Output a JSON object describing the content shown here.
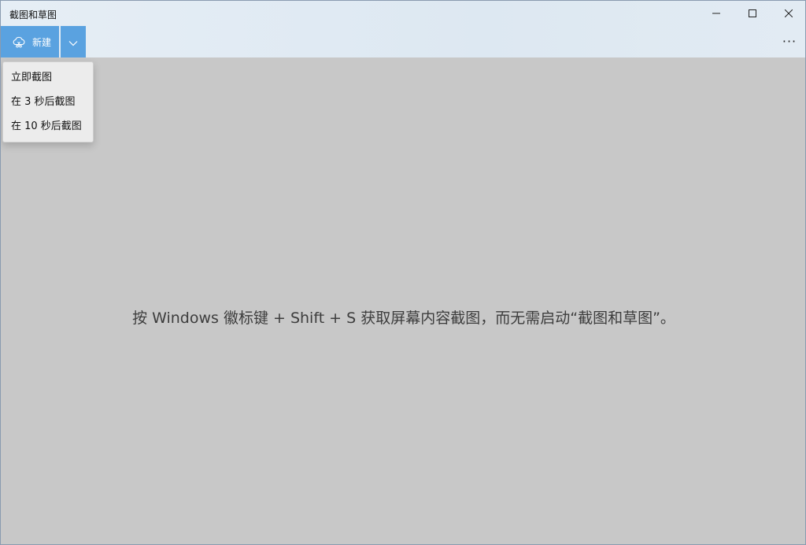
{
  "window": {
    "title": "截图和草图"
  },
  "title_bar_controls": {
    "minimize_icon": "minimize-icon",
    "maximize_icon": "maximize-icon",
    "close_icon": "close-icon"
  },
  "toolbar": {
    "new_label": "新建",
    "new_icon": "snip-cloud-icon",
    "dropdown_icon": "chevron-down-icon",
    "more_label": "···",
    "accent_color": "#5aa2e0"
  },
  "delay_menu": {
    "items": [
      {
        "label": "立即截图"
      },
      {
        "label": "在 3 秒后截图"
      },
      {
        "label": "在 10 秒后截图"
      }
    ]
  },
  "main": {
    "hint_text": "按 Windows 徽标键 + Shift + S 获取屏幕内容截图，而无需启动“截图和草图”。",
    "background_color": "#c8c8c8"
  }
}
